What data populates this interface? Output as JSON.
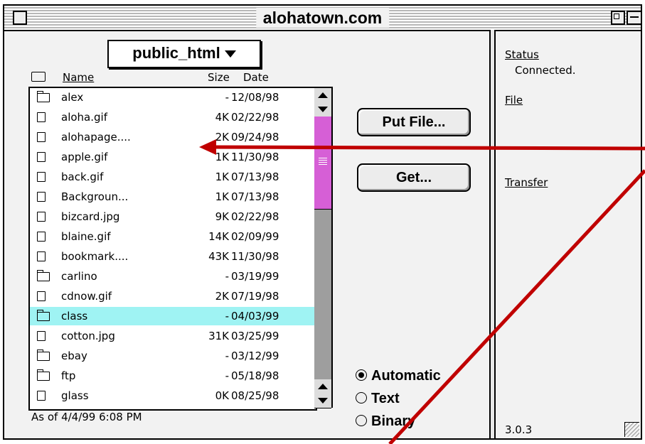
{
  "window": {
    "title": "alohatown.com"
  },
  "folder_popup": {
    "label": "public_html"
  },
  "columns": {
    "name": "Name",
    "size": "Size",
    "date": "Date"
  },
  "files": [
    {
      "name": "alex",
      "size": "-",
      "date": "12/08/98",
      "type": "folder"
    },
    {
      "name": "aloha.gif",
      "size": "4K",
      "date": "02/22/98",
      "type": "file"
    },
    {
      "name": "alohapage....",
      "size": "2K",
      "date": "09/24/98",
      "type": "file"
    },
    {
      "name": "apple.gif",
      "size": "1K",
      "date": "11/30/98",
      "type": "file"
    },
    {
      "name": "back.gif",
      "size": "1K",
      "date": "07/13/98",
      "type": "file"
    },
    {
      "name": "Backgroun...",
      "size": "1K",
      "date": "07/13/98",
      "type": "file"
    },
    {
      "name": "bizcard.jpg",
      "size": "9K",
      "date": "02/22/98",
      "type": "file"
    },
    {
      "name": "blaine.gif",
      "size": "14K",
      "date": "02/09/99",
      "type": "file"
    },
    {
      "name": "bookmark....",
      "size": "43K",
      "date": "11/30/98",
      "type": "file"
    },
    {
      "name": "carlino",
      "size": "-",
      "date": "03/19/99",
      "type": "folder"
    },
    {
      "name": "cdnow.gif",
      "size": "2K",
      "date": "07/19/98",
      "type": "file"
    },
    {
      "name": "class",
      "size": "-",
      "date": "04/03/99",
      "type": "folder",
      "selected": true
    },
    {
      "name": "cotton.jpg",
      "size": "31K",
      "date": "03/25/99",
      "type": "file"
    },
    {
      "name": "ebay",
      "size": "-",
      "date": "03/12/99",
      "type": "folder"
    },
    {
      "name": "ftp",
      "size": "-",
      "date": "05/18/98",
      "type": "folder"
    },
    {
      "name": "glass",
      "size": "0K",
      "date": "08/25/98",
      "type": "file"
    }
  ],
  "status_line": "As of 4/4/99 6:08 PM",
  "buttons": {
    "put_file": "Put File...",
    "get": "Get..."
  },
  "transfer_mode": {
    "options": [
      "Automatic",
      "Text",
      "Binary"
    ],
    "selected": "Automatic"
  },
  "right_panel": {
    "status_label": "Status",
    "status_value": "Connected.",
    "file_label": "File",
    "transfer_label": "Transfer",
    "version": "3.0.3"
  },
  "colors": {
    "selection": "#9ff3f3",
    "scroll_thumb": "#d65fd6",
    "annotation_arrow": "#c00000"
  }
}
